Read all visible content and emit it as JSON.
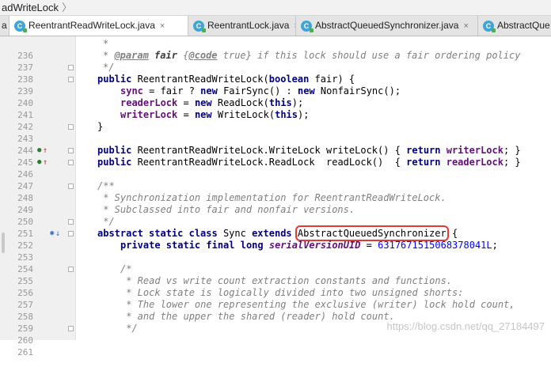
{
  "breadcrumb": {
    "text": "adWriteLock"
  },
  "tabs": [
    {
      "label": "a",
      "active": false
    },
    {
      "label": "ReentrantReadWriteLock.java",
      "active": true
    },
    {
      "label": "ReentrantLock.java",
      "active": false
    },
    {
      "label": "AbstractQueuedSynchronizer.java",
      "active": false
    },
    {
      "label": "AbstractQue",
      "active": false
    }
  ],
  "icons": {
    "class_icon": "C",
    "close": "×",
    "chevron": "〉"
  },
  "watermark": "https://blog.csdn.net/qq_27184497",
  "lines": [
    {
      "n": "236"
    },
    {
      "n": "237"
    },
    {
      "n": "238"
    },
    {
      "n": "239"
    },
    {
      "n": "240"
    },
    {
      "n": "241"
    },
    {
      "n": "242"
    },
    {
      "n": "243"
    },
    {
      "n": "244"
    },
    {
      "n": "245"
    },
    {
      "n": "246"
    },
    {
      "n": "247"
    },
    {
      "n": "248"
    },
    {
      "n": "249"
    },
    {
      "n": "250"
    },
    {
      "n": "251"
    },
    {
      "n": "252"
    },
    {
      "n": "253"
    },
    {
      "n": "254"
    },
    {
      "n": "255"
    },
    {
      "n": "256"
    },
    {
      "n": "257"
    },
    {
      "n": "258"
    },
    {
      "n": "259"
    },
    {
      "n": "260"
    },
    {
      "n": "261"
    }
  ],
  "code": {
    "l236": "*",
    "l237_star": "* ",
    "l237_tag": "@param",
    "l237_name": "fair",
    "l237_rest1": " {",
    "l237_code": "@code",
    "l237_rest2": " true} if this lock should use a fair ordering policy",
    "l238": "*/",
    "l239_kw": "public",
    "l239_rest1": " ReentrantReadWriteLock(",
    "l239_kw2": "boolean",
    "l239_rest2": " fair) {",
    "l240_f": "sync",
    "l240_r1": " = fair ? ",
    "l240_kw": "new",
    "l240_r2": " FairSync() : ",
    "l240_kw2": "new",
    "l240_r3": " NonfairSync();",
    "l241_f": "readerLock",
    "l241_r1": " = ",
    "l241_kw": "new",
    "l241_r2": " ReadLock(",
    "l241_kw2": "this",
    "l241_r3": ");",
    "l242_f": "writerLock",
    "l242_r1": " = ",
    "l242_kw": "new",
    "l242_r2": " WriteLock(",
    "l242_kw2": "this",
    "l242_r3": ");",
    "l243": "}",
    "l245_kw": "public",
    "l245_r1": " ReentrantReadWriteLock.WriteLock writeLock() { ",
    "l245_kw2": "return",
    "l245_r2": " ",
    "l245_f": "writerLock",
    "l245_r3": "; }",
    "l246_kw": "public",
    "l246_r1": " ReentrantReadWriteLock.ReadLock  readLock()  { ",
    "l246_kw2": "return",
    "l246_r2": " ",
    "l246_f": "readerLock",
    "l246_r3": "; }",
    "l248": "/**",
    "l249": " * Synchronization implementation for ReentrantReadWriteLock.",
    "l250": " * Subclassed into fair and nonfair versions.",
    "l251": " */",
    "l252_kw": "abstract static class",
    "l252_r1": " Sync ",
    "l252_kw2": "extends",
    "l252_r2": " ",
    "l252_hl": "AbstractQueuedSynchronizer",
    "l252_r3": " {",
    "l253_kw": "private static final long",
    "l253_r1": " ",
    "l253_sf": "serialVersionUID",
    "l253_r2": " = ",
    "l253_num": "6317671515068378041L",
    "l253_r3": ";",
    "l255": "/*",
    "l256": " * Read vs write count extraction constants and functions.",
    "l257": " * Lock state is logically divided into two unsigned shorts:",
    "l258": " * The lower one representing the exclusive (writer) lock hold count,",
    "l259": " * and the upper the shared (reader) hold count.",
    "l260": " */"
  },
  "gutter_marks": {
    "override": "●",
    "up_arrow": "↑",
    "implemented": "◉",
    "down_arrow": "↓"
  }
}
